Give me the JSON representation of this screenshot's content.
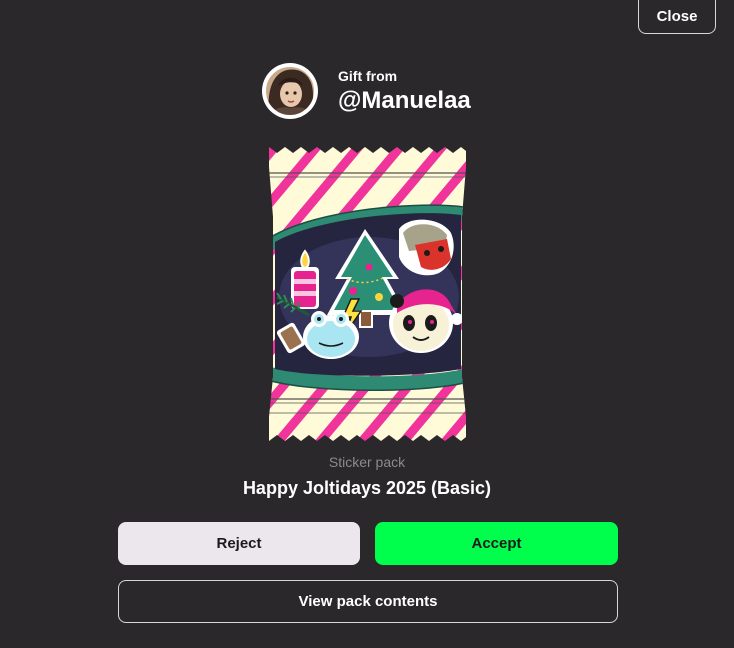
{
  "header": {
    "close_label": "Close"
  },
  "gift": {
    "label": "Gift from",
    "username": "@Manuelaa"
  },
  "pack": {
    "type_label": "Sticker pack",
    "name": "Happy Joltidays 2025 (Basic)",
    "stickers": [
      "candle-sticker",
      "christmas-tree-sticker",
      "red-mask-sticker",
      "santa-panda-sticker",
      "snow-frog-sticker",
      "lightning-sticker",
      "pine-branch-sticker"
    ]
  },
  "actions": {
    "reject_label": "Reject",
    "accept_label": "Accept",
    "view_label": "View pack contents"
  },
  "colors": {
    "background": "#2b282b",
    "accept": "#00ff4c",
    "reject": "#ebe7ec",
    "stripe": "#f0349c",
    "wrapper": "#fffbd9"
  }
}
